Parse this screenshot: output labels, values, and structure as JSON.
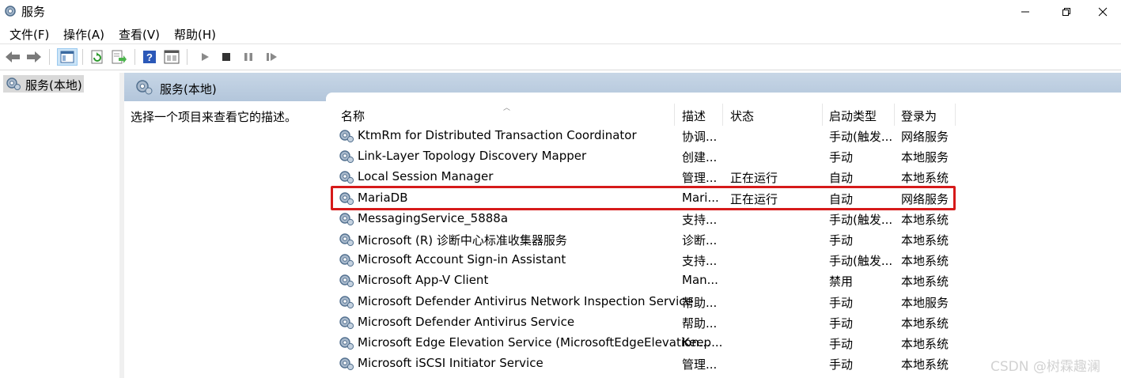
{
  "window": {
    "title": "服务"
  },
  "menu": [
    "文件(F)",
    "操作(A)",
    "查看(V)",
    "帮助(H)"
  ],
  "toolbar": {
    "icons": [
      "back-arrow-icon",
      "forward-arrow-icon",
      "show-console-tree-icon",
      "refresh-icon",
      "export-list-icon",
      "help-icon",
      "properties-icon",
      "start-service-icon",
      "stop-service-icon",
      "pause-service-icon",
      "resume-service-icon"
    ]
  },
  "tree": {
    "root_label": "服务(本地)"
  },
  "pane": {
    "header_title": "服务(本地)",
    "description_prompt": "选择一个项目来查看它的描述。"
  },
  "table": {
    "columns": [
      "名称",
      "描述",
      "状态",
      "启动类型",
      "登录为"
    ],
    "rows": [
      {
        "name": "KtmRm for Distributed Transaction Coordinator",
        "desc": "协调...",
        "status": "",
        "startup": "手动(触发...",
        "logon": "网络服务"
      },
      {
        "name": "Link-Layer Topology Discovery Mapper",
        "desc": "创建...",
        "status": "",
        "startup": "手动",
        "logon": "本地服务"
      },
      {
        "name": "Local Session Manager",
        "desc": "管理...",
        "status": "正在运行",
        "startup": "自动",
        "logon": "本地系统"
      },
      {
        "name": "MariaDB",
        "desc": "Mari...",
        "status": "正在运行",
        "startup": "自动",
        "logon": "网络服务"
      },
      {
        "name": "MessagingService_5888a",
        "desc": "支持...",
        "status": "",
        "startup": "手动(触发...",
        "logon": "本地系统"
      },
      {
        "name": "Microsoft (R) 诊断中心标准收集器服务",
        "desc": "诊断...",
        "status": "",
        "startup": "手动",
        "logon": "本地系统"
      },
      {
        "name": "Microsoft Account Sign-in Assistant",
        "desc": "支持...",
        "status": "",
        "startup": "手动(触发...",
        "logon": "本地系统"
      },
      {
        "name": "Microsoft App-V Client",
        "desc": "Man...",
        "status": "",
        "startup": "禁用",
        "logon": "本地系统"
      },
      {
        "name": "Microsoft Defender Antivirus Network Inspection Service",
        "desc": "帮助...",
        "status": "",
        "startup": "手动",
        "logon": "本地服务"
      },
      {
        "name": "Microsoft Defender Antivirus Service",
        "desc": "帮助...",
        "status": "",
        "startup": "手动",
        "logon": "本地系统"
      },
      {
        "name": "Microsoft Edge Elevation Service (MicrosoftEdgeElevation...",
        "desc": "Keep...",
        "status": "",
        "startup": "手动",
        "logon": "本地系统"
      },
      {
        "name": "Microsoft iSCSI Initiator Service",
        "desc": "管理...",
        "status": "",
        "startup": "手动",
        "logon": "本地系统"
      }
    ],
    "highlighted_row": "MariaDB"
  },
  "watermark": "CSDN @树霖趣澜",
  "colors": {
    "highlight": "#d61a1a",
    "header_bg": "#c7d6e6",
    "selection": "#d9d9d9"
  }
}
